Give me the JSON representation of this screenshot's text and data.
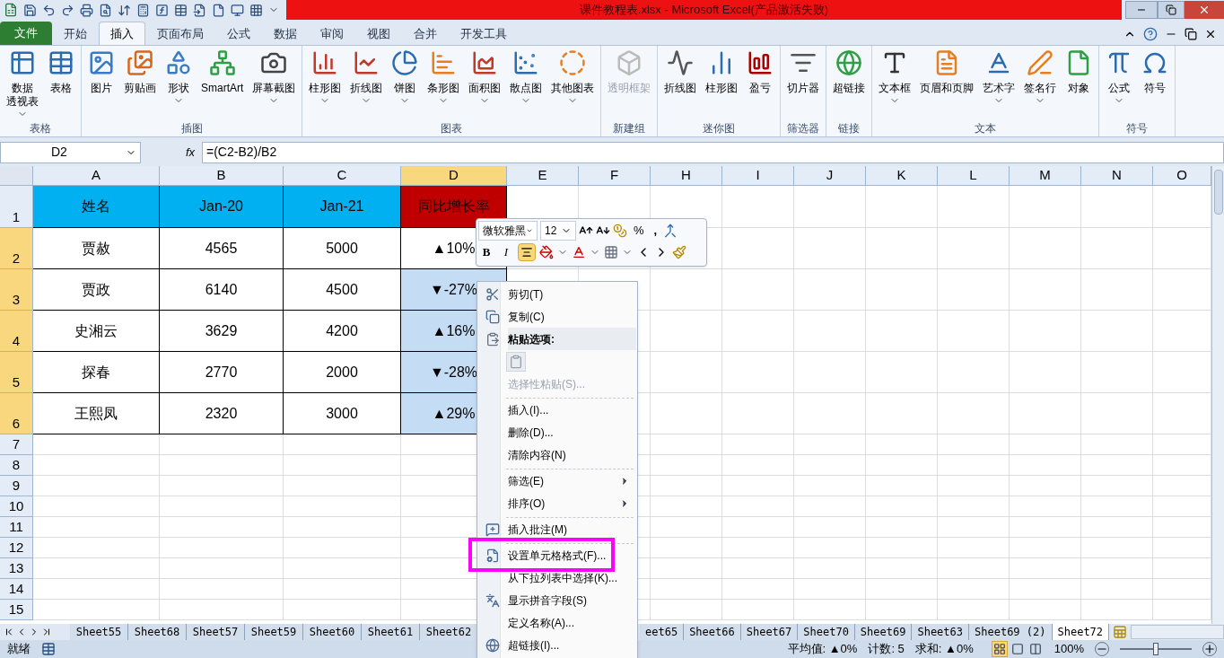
{
  "window": {
    "title": "课件教程表.xlsx - Microsoft Excel(产品激活失败)"
  },
  "ribbon_tabs": [
    {
      "label": "文件",
      "kind": "file",
      "selected": false
    },
    {
      "label": "开始",
      "kind": "tab",
      "selected": false
    },
    {
      "label": "插入",
      "kind": "tab",
      "selected": true
    },
    {
      "label": "页面布局",
      "kind": "tab",
      "selected": false
    },
    {
      "label": "公式",
      "kind": "tab",
      "selected": false
    },
    {
      "label": "数据",
      "kind": "tab",
      "selected": false
    },
    {
      "label": "审阅",
      "kind": "tab",
      "selected": false
    },
    {
      "label": "视图",
      "kind": "tab",
      "selected": false
    },
    {
      "label": "合并",
      "kind": "tab",
      "selected": false
    },
    {
      "label": "开发工具",
      "kind": "tab",
      "selected": false
    }
  ],
  "ribbon_groups": [
    {
      "name": "表格",
      "items": [
        {
          "lines": [
            "数据",
            "透视表"
          ],
          "dropdown": true,
          "disabled": false
        },
        {
          "label": "表格",
          "dropdown": false,
          "disabled": false
        }
      ]
    },
    {
      "name": "插图",
      "items": [
        {
          "label": "图片",
          "dropdown": false,
          "disabled": false
        },
        {
          "label": "剪贴画",
          "dropdown": false,
          "disabled": false
        },
        {
          "label": "形状",
          "dropdown": true,
          "disabled": false
        },
        {
          "label": "SmartArt",
          "dropdown": false,
          "disabled": false
        },
        {
          "label": "屏幕截图",
          "dropdown": true,
          "disabled": false
        }
      ]
    },
    {
      "name": "图表",
      "items": [
        {
          "label": "柱形图",
          "dropdown": true,
          "disabled": false
        },
        {
          "label": "折线图",
          "dropdown": true,
          "disabled": false
        },
        {
          "label": "饼图",
          "dropdown": true,
          "disabled": false
        },
        {
          "label": "条形图",
          "dropdown": true,
          "disabled": false
        },
        {
          "label": "面积图",
          "dropdown": true,
          "disabled": false
        },
        {
          "label": "散点图",
          "dropdown": true,
          "disabled": false
        },
        {
          "label": "其他图表",
          "dropdown": true,
          "disabled": false
        }
      ]
    },
    {
      "name": "新建组",
      "items": [
        {
          "label": "透明框架",
          "dropdown": false,
          "disabled": true
        }
      ]
    },
    {
      "name": "迷你图",
      "items": [
        {
          "label": "折线图",
          "dropdown": false,
          "disabled": false
        },
        {
          "label": "柱形图",
          "dropdown": false,
          "disabled": false
        },
        {
          "label": "盈亏",
          "dropdown": false,
          "disabled": false
        }
      ]
    },
    {
      "name": "筛选器",
      "items": [
        {
          "label": "切片器",
          "dropdown": false,
          "disabled": false
        }
      ]
    },
    {
      "name": "链接",
      "items": [
        {
          "label": "超链接",
          "dropdown": false,
          "disabled": false
        }
      ]
    },
    {
      "name": "文本",
      "items": [
        {
          "label": "文本框",
          "dropdown": true,
          "disabled": false
        },
        {
          "label": "页眉和页脚",
          "dropdown": false,
          "disabled": false
        },
        {
          "label": "艺术字",
          "dropdown": true,
          "disabled": false
        },
        {
          "label": "签名行",
          "dropdown": true,
          "disabled": false
        },
        {
          "label": "对象",
          "dropdown": false,
          "disabled": false
        }
      ]
    },
    {
      "name": "符号",
      "items": [
        {
          "label": "公式",
          "dropdown": true,
          "disabled": false
        },
        {
          "label": "符号",
          "dropdown": false,
          "disabled": false
        }
      ]
    }
  ],
  "formula_bar": {
    "name_box": "D2",
    "fx": "fx",
    "formula": "=(C2-B2)/B2"
  },
  "sheet": {
    "columns": [
      {
        "label": "A",
        "selected": false
      },
      {
        "label": "B",
        "selected": false
      },
      {
        "label": "C",
        "selected": false
      },
      {
        "label": "D",
        "selected": true
      },
      {
        "label": "E",
        "selected": false
      },
      {
        "label": "F",
        "selected": false
      },
      {
        "label": "H",
        "selected": false
      },
      {
        "label": "I",
        "selected": false
      },
      {
        "label": "J",
        "selected": false
      },
      {
        "label": "K",
        "selected": false
      },
      {
        "label": "L",
        "selected": false
      },
      {
        "label": "M",
        "selected": false
      },
      {
        "label": "N",
        "selected": false
      },
      {
        "label": "O",
        "selected": false
      }
    ],
    "rows": [
      {
        "number": "1",
        "selected": false,
        "cells": [
          {
            "text": "姓名",
            "color": "#00b0f0"
          },
          {
            "text": "Jan-20",
            "color": "#00b0f0"
          },
          {
            "text": "Jan-21",
            "color": "#00b0f0"
          },
          {
            "text": "同比增长率",
            "color": "#c00000"
          }
        ]
      },
      {
        "number": "2",
        "selected": true,
        "cells": [
          {
            "text": "贾赦",
            "selected": false
          },
          {
            "text": "4565",
            "selected": false
          },
          {
            "text": "5000",
            "selected": false
          },
          {
            "text": "▲10%",
            "selected": false
          }
        ]
      },
      {
        "number": "3",
        "selected": true,
        "cells": [
          {
            "text": "贾政",
            "selected": false
          },
          {
            "text": "6140",
            "selected": false
          },
          {
            "text": "4500",
            "selected": false
          },
          {
            "text": "▼-27%",
            "selected": true
          }
        ]
      },
      {
        "number": "4",
        "selected": true,
        "cells": [
          {
            "text": "史湘云",
            "selected": false
          },
          {
            "text": "3629",
            "selected": false
          },
          {
            "text": "4200",
            "selected": false
          },
          {
            "text": "▲16%",
            "selected": true
          }
        ]
      },
      {
        "number": "5",
        "selected": true,
        "cells": [
          {
            "text": "探春",
            "selected": false
          },
          {
            "text": "2770",
            "selected": false
          },
          {
            "text": "2000",
            "selected": false
          },
          {
            "text": "▼-28%",
            "selected": true
          }
        ]
      },
      {
        "number": "6",
        "selected": true,
        "cells": [
          {
            "text": "王熙凤",
            "selected": false
          },
          {
            "text": "2320",
            "selected": false
          },
          {
            "text": "3000",
            "selected": false
          },
          {
            "text": "▲29%",
            "selected": true
          }
        ]
      },
      {
        "number": "7",
        "selected": false,
        "cells": []
      },
      {
        "number": "8",
        "selected": false,
        "cells": []
      },
      {
        "number": "9",
        "selected": false,
        "cells": []
      },
      {
        "number": "10",
        "selected": false,
        "cells": []
      },
      {
        "number": "11",
        "selected": false,
        "cells": []
      },
      {
        "number": "12",
        "selected": false,
        "cells": []
      },
      {
        "number": "13",
        "selected": false,
        "cells": []
      },
      {
        "number": "14",
        "selected": false,
        "cells": []
      },
      {
        "number": "15",
        "selected": false,
        "cells": []
      }
    ]
  },
  "mini_toolbar": {
    "font": "微软雅黑",
    "size": "12",
    "percent": "%",
    "comma": ",",
    "bold": "B",
    "italic": "I",
    "center_selected": true
  },
  "context_menu": [
    {
      "kind": "item",
      "label": "剪切(T)",
      "disabled": false,
      "submenu": false,
      "highlighted": false
    },
    {
      "kind": "item",
      "label": "复制(C)",
      "disabled": false,
      "submenu": false,
      "highlighted": false
    },
    {
      "kind": "header",
      "label": "粘贴选项:"
    },
    {
      "kind": "paste"
    },
    {
      "kind": "item",
      "label": "选择性粘贴(S)...",
      "disabled": true,
      "submenu": false,
      "highlighted": false
    },
    {
      "kind": "separator"
    },
    {
      "kind": "item",
      "label": "插入(I)...",
      "disabled": false,
      "submenu": false,
      "highlighted": false
    },
    {
      "kind": "item",
      "label": "删除(D)...",
      "disabled": false,
      "submenu": false,
      "highlighted": false
    },
    {
      "kind": "item",
      "label": "清除内容(N)",
      "disabled": false,
      "submenu": false,
      "highlighted": false
    },
    {
      "kind": "separator"
    },
    {
      "kind": "item",
      "label": "筛选(E)",
      "disabled": false,
      "submenu": true,
      "highlighted": false
    },
    {
      "kind": "item",
      "label": "排序(O)",
      "disabled": false,
      "submenu": true,
      "highlighted": false
    },
    {
      "kind": "separator"
    },
    {
      "kind": "item",
      "label": "插入批注(M)",
      "disabled": false,
      "submenu": false,
      "highlighted": false
    },
    {
      "kind": "separator"
    },
    {
      "kind": "item",
      "label": "设置单元格格式(F)...",
      "disabled": false,
      "submenu": false,
      "highlighted": true
    },
    {
      "kind": "item",
      "label": "从下拉列表中选择(K)...",
      "disabled": false,
      "submenu": false,
      "highlighted": false
    },
    {
      "kind": "item",
      "label": "显示拼音字段(S)",
      "disabled": false,
      "submenu": false,
      "highlighted": false
    },
    {
      "kind": "item",
      "label": "定义名称(A)...",
      "disabled": false,
      "submenu": false,
      "highlighted": false
    },
    {
      "kind": "item",
      "label": "超链接(I)...",
      "disabled": false,
      "submenu": false,
      "highlighted": false
    }
  ],
  "sheet_tabs_left": [
    {
      "label": "Sheet55",
      "selected": false
    },
    {
      "label": "Sheet68",
      "selected": false
    },
    {
      "label": "Sheet57",
      "selected": false
    },
    {
      "label": "Sheet59",
      "selected": false
    },
    {
      "label": "Sheet60",
      "selected": false
    },
    {
      "label": "Sheet61",
      "selected": false
    },
    {
      "label": "Sheet62",
      "selected": false
    }
  ],
  "sheet_tabs_right": [
    {
      "label": "eet65",
      "selected": false
    },
    {
      "label": "Sheet66",
      "selected": false
    },
    {
      "label": "Sheet67",
      "selected": false
    },
    {
      "label": "Sheet70",
      "selected": false
    },
    {
      "label": "Sheet69",
      "selected": false
    },
    {
      "label": "Sheet63",
      "selected": false
    },
    {
      "label": "Sheet69 (2)",
      "selected": false
    },
    {
      "label": "Sheet72",
      "selected": true
    }
  ],
  "status_bar": {
    "ready": "就绪",
    "average": "平均值: ▲0%",
    "count": "计数: 5",
    "sum": "求和: ▲0%",
    "views": [
      {
        "kind": "normal",
        "selected": true
      },
      {
        "kind": "layout",
        "selected": false
      },
      {
        "kind": "pagebreak",
        "selected": false
      }
    ],
    "zoom": "100%",
    "zoom_slider": {
      "level": 0.5
    }
  }
}
